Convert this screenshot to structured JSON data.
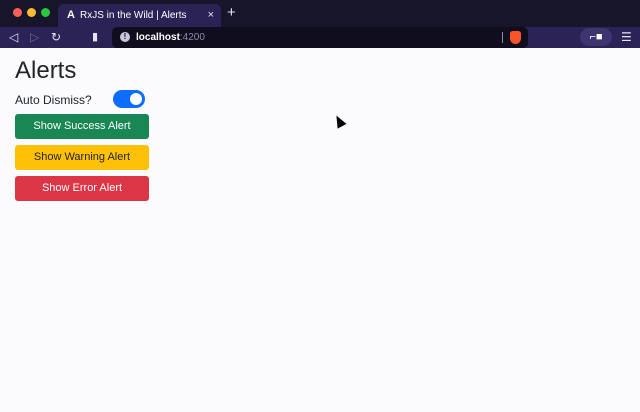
{
  "browser": {
    "tab": {
      "favicon": "angular-icon",
      "title": "RxJS in the Wild | Alerts",
      "close": "×"
    },
    "new_tab": "+",
    "url": {
      "host": "localhost",
      "port": ":4200"
    },
    "nav": {
      "back": "◁",
      "forward": "▷",
      "reload": "↻",
      "bookmark": "🔖",
      "menu": "☰",
      "extension": "👓"
    }
  },
  "page": {
    "title": "Alerts",
    "auto_dismiss_label": "Auto Dismiss?",
    "auto_dismiss_on": true,
    "buttons": {
      "success": "Show Success Alert",
      "warning": "Show Warning Alert",
      "error": "Show Error Alert"
    }
  },
  "colors": {
    "success": "#198754",
    "warning": "#ffc107",
    "danger": "#dc3545",
    "toggle_on": "#0d6efd"
  }
}
